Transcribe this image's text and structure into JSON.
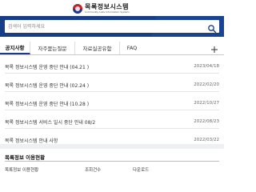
{
  "header": {
    "logo_ko": "목록정보시스템",
    "logo_en": "Commodity Lists Information System"
  },
  "search": {
    "placeholder": "검색어 입력하세요"
  },
  "tabs": [
    {
      "label": "공지사항",
      "active": true
    },
    {
      "label": "자주묻는질문",
      "active": false
    },
    {
      "label": "자료실공유함",
      "active": false
    },
    {
      "label": "FAQ",
      "active": false
    }
  ],
  "notices": [
    {
      "title": "목록 정보시스템 운영 중단 안내 (04.21 )",
      "date": "2023/04/18"
    },
    {
      "title": "목록 정보시스템 운영 중단 안내 (02.24 )",
      "date": "2022/02/20"
    },
    {
      "title": "목록 정보시스템 운영 중단 안내 (10.28 )",
      "date": "2022/10/27"
    },
    {
      "title": "목록 정보시스템 서비스 일시 중단 안내 08/2",
      "date": "2022/08/23"
    },
    {
      "title": "목록 정보시스템 안내 사항",
      "date": "2022/03/22"
    }
  ],
  "section2": {
    "title": "목록정보 이용현황",
    "columns": [
      "목록정보 이용현황",
      "조회건수",
      "다운로드"
    ]
  },
  "colors": {
    "brand_blue": "#163d86"
  }
}
